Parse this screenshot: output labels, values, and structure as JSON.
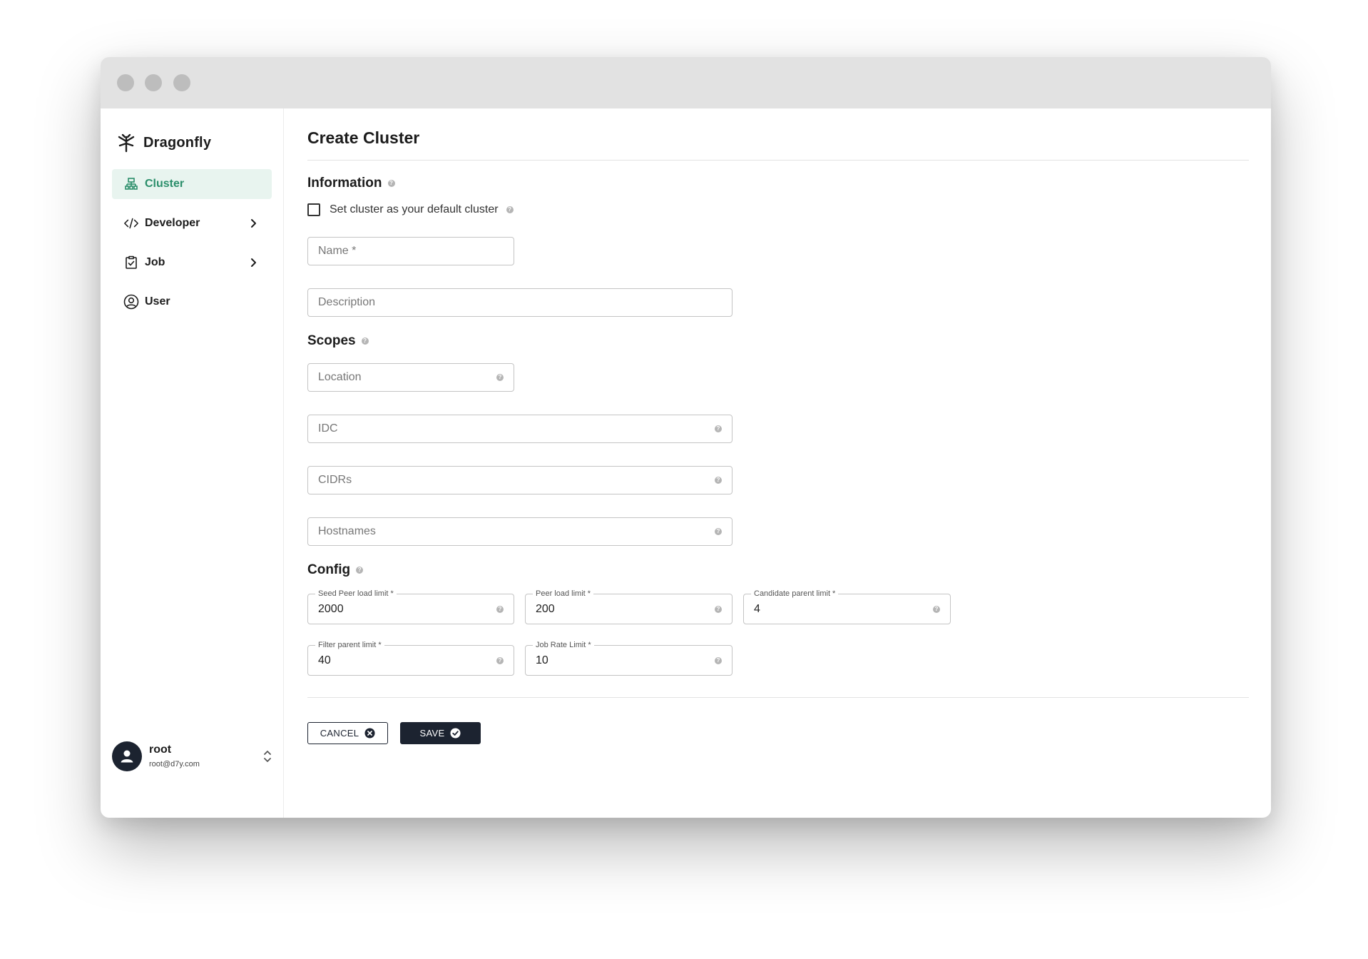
{
  "app": {
    "brand": "Dragonfly"
  },
  "sidebar": {
    "items": [
      {
        "label": "Cluster",
        "icon": "cluster-icon",
        "active": true,
        "expandable": false
      },
      {
        "label": "Developer",
        "icon": "code-icon",
        "active": false,
        "expandable": true
      },
      {
        "label": "Job",
        "icon": "clipboard-check-icon",
        "active": false,
        "expandable": true
      },
      {
        "label": "User",
        "icon": "user-circle-icon",
        "active": false,
        "expandable": false
      }
    ],
    "user": {
      "name": "root",
      "email": "root@d7y.com"
    }
  },
  "page": {
    "title": "Create Cluster"
  },
  "information": {
    "title": "Information",
    "default_checkbox_label": "Set cluster as your default cluster",
    "default_checked": false,
    "name_placeholder": "Name *",
    "description_placeholder": "Description"
  },
  "scopes": {
    "title": "Scopes",
    "location_placeholder": "Location",
    "idc_placeholder": "IDC",
    "cidrs_placeholder": "CIDRs",
    "hostnames_placeholder": "Hostnames"
  },
  "config": {
    "title": "Config",
    "seed_peer_load_limit": {
      "label": "Seed Peer load limit *",
      "value": "2000"
    },
    "peer_load_limit": {
      "label": "Peer load limit *",
      "value": "200"
    },
    "candidate_parent_limit": {
      "label": "Candidate parent limit *",
      "value": "4"
    },
    "filter_parent_limit": {
      "label": "Filter parent limit *",
      "value": "40"
    },
    "job_rate_limit": {
      "label": "Job Rate Limit *",
      "value": "10"
    }
  },
  "actions": {
    "cancel_label": "CANCEL",
    "save_label": "SAVE"
  },
  "colors": {
    "accent": "#2a8e6a",
    "active_bg": "#e8f4ef",
    "primary_dark": "#1c2330"
  }
}
